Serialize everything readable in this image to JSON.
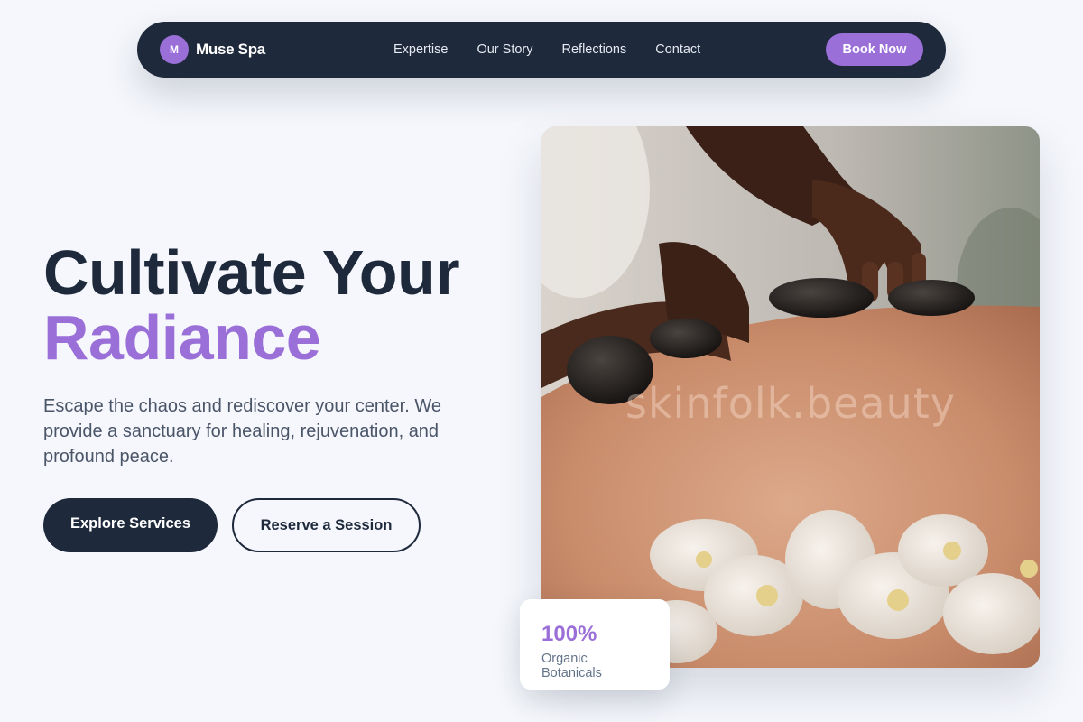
{
  "nav": {
    "logo_letter": "M",
    "brand": "Muse Spa",
    "links": [
      "Expertise",
      "Our Story",
      "Reflections",
      "Contact"
    ],
    "cta": "Book Now"
  },
  "hero": {
    "headline_line1": "Cultivate Your",
    "headline_line2": "Radiance",
    "subtitle": "Escape the chaos and rediscover your center. We provide a sanctuary for healing, rejuvenation, and profound peace.",
    "primary_button": "Explore Services",
    "secondary_button": "Reserve a Session"
  },
  "image": {
    "watermark": "skinfolk.beauty"
  },
  "stat": {
    "value": "100%",
    "label": "Organic Botanicals"
  },
  "colors": {
    "navy": "#1e293b",
    "accent": "#9b6fd8",
    "background": "#f5f7fc"
  }
}
